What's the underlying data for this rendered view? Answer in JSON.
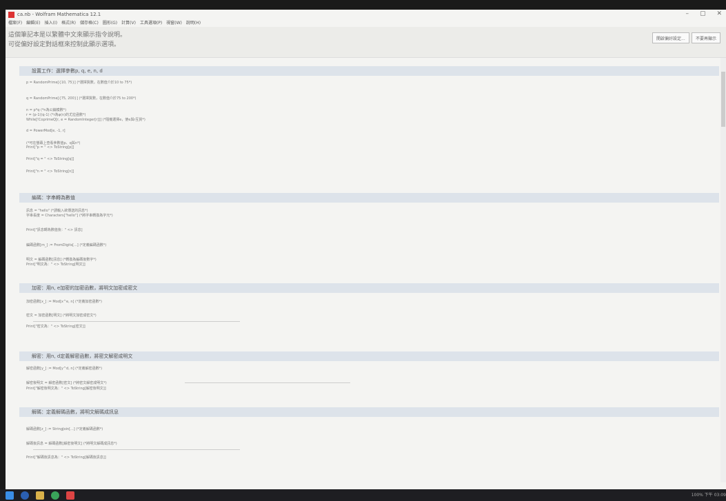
{
  "window": {
    "title": "ca.nb - Wolfram Mathematica 12.1",
    "min": "–",
    "max": "▢",
    "close": "✕"
  },
  "menu": [
    "檔案(F)",
    "編輯(E)",
    "插入(I)",
    "格式(R)",
    "儲存格(C)",
    "圖形(G)",
    "計算(V)",
    "工具選項(P)",
    "視窗(W)",
    "說明(H)"
  ],
  "banner": {
    "line1": "這個筆記本是以繁體中文來顯示指令說明。",
    "line2": "可從偏好設定對話框來控制此顯示選項。",
    "btn1": "開啟偏好設定...",
    "btn2": "不要再顯示"
  },
  "sections": [
    {
      "title": "設置工作：選擇參數p, q, e, n, d"
    },
    {
      "title": "編碼：字串轉為數值"
    },
    {
      "title": "加密：用n, e加密的加密函數，將明文加密成密文"
    },
    {
      "title": "解密：用n, d定義解密函數，將密文解密成明文"
    },
    {
      "title": "解碼：定義解碼函數，將明文解碼成訊息"
    }
  ],
  "code": [
    "p = RandomPrime[{10, 75}] (*選擇質數，在數值介於10 to 75*)",
    "q = RandomPrime[{75, 200}] (*選擇質數，在數值介於75 to 200*)",
    "n = p*q (*n為公鑰模數*)",
    "r = (p-1)(q-1) (*r為φ(n)的尤拉函數*)",
    "While[!CoprimeQ[r, e = RandomInteger[r]]] (*隨機選擇e，使e與r互質*)",
    "d = PowerMod[e, -1, r]",
    "(*可在螢幕上查看參數值p、q與n*)",
    "Print[\"p = \" <> ToString[p]]",
    "Print[\"q = \" <> ToString[q]]",
    "Print[\"n = \" <> ToString[n]]",
    "訊息 = \"hello\" (*請輸入欲傳送的訊息*)",
    "字串長度 = Characters[\"hello\"] (*將字串轉換為字元*)",
    "Print[\"訊息轉為數值後：\" <> 訊息]",
    "編碼函數[m_] := FromDigits[...] (*定義編碼函數*)",
    "明文 = 編碼函數[訊息] (*轉換為編碼後數字*)",
    "Print[\"明文為：\" <> ToString[明文]]",
    "加密函數[x_] := Mod[x^e, n] (*定義加密函數*)",
    "密文 = 加密函數[明文] (*將明文加密成密文*)",
    "Print[\"密文為：\" <> ToString[密文]]",
    "解密函數[y_] := Mod[y^d, n] (*定義解密函數*)",
    "解密後明文 = 解密函數[密文] (*將密文解密成明文*)",
    "Print[\"解密後明文為：\" <> ToString[解密後明文]]",
    "解碼函數[z_] := StringJoin[...] (*定義解碼函數*)",
    "解碼後訊息 = 解碼函數[解密後明文] (*將明文解碼成訊息*)",
    "Print[\"解碼後訊息為：\" <> ToString[解碼後訊息]]"
  ],
  "tray": {
    "zoom": "100%",
    "time": "下午 03:09"
  }
}
